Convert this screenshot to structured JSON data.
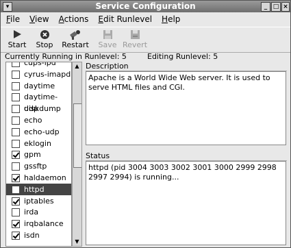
{
  "window": {
    "title": "Service Configuration"
  },
  "menu": [
    "File",
    "View",
    "Actions",
    "Edit Runlevel",
    "Help"
  ],
  "toolbar": {
    "start": "Start",
    "stop": "Stop",
    "restart": "Restart",
    "save": "Save",
    "revert": "Revert"
  },
  "info": {
    "running": "Currently Running in Runlevel: 5",
    "editing": "Editing Runlevel: 5"
  },
  "services": [
    {
      "name": "cups-lpd",
      "checked": false
    },
    {
      "name": "cyrus-imapd",
      "checked": false
    },
    {
      "name": "daytime",
      "checked": false
    },
    {
      "name": "daytime-udp",
      "checked": false
    },
    {
      "name": "diskdump",
      "checked": false
    },
    {
      "name": "echo",
      "checked": false
    },
    {
      "name": "echo-udp",
      "checked": false
    },
    {
      "name": "eklogin",
      "checked": false
    },
    {
      "name": "gpm",
      "checked": true
    },
    {
      "name": "gssftp",
      "checked": false
    },
    {
      "name": "haldaemon",
      "checked": true
    },
    {
      "name": "httpd",
      "checked": false,
      "selected": true
    },
    {
      "name": "iptables",
      "checked": true
    },
    {
      "name": "irda",
      "checked": false
    },
    {
      "name": "irqbalance",
      "checked": true
    },
    {
      "name": "isdn",
      "checked": true
    }
  ],
  "description": {
    "title": "Description",
    "text": "Apache is a World Wide Web server.  It is used to serve HTML files and CGI."
  },
  "status": {
    "title": "Status",
    "text": "httpd (pid 3004 3003 3002 3001 3000 2999 2998 2997 2994) is running..."
  }
}
